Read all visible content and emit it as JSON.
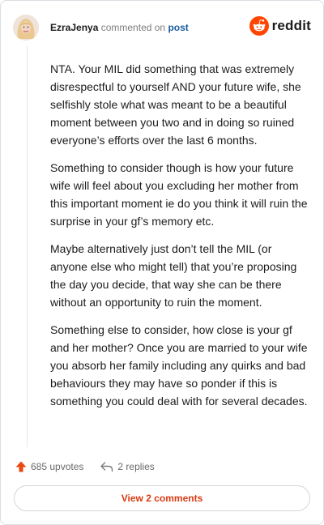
{
  "comment": {
    "username": "EzraJenya",
    "action_text": "commented on",
    "post_link": "post",
    "paragraphs": [
      "NTA. Your MIL did something that was extremely disrespectful to yourself AND your future wife, she selfishly stole what was meant to be a beautiful moment between you two and in doing so ruined everyone’s efforts over the last 6 months.",
      "Something to consider though is how your future wife will feel about you excluding her mother from this important moment ie do you think it will ruin the surprise in your gf’s memory etc.",
      "Maybe alternatively just don’t tell the MIL (or anyone else who might tell) that you’re proposing the day you decide, that way she can be there without an opportunity to ruin the moment.",
      "Something else to consider, how close is your gf and her mother? Once you are married to your wife you absorb her family including any quirks and bad behaviours they may have so ponder if this is something you could deal with for several decades."
    ]
  },
  "brand": {
    "wordmark": "reddit",
    "color": "#ff4500"
  },
  "actions": {
    "upvotes": "685 upvotes",
    "replies": "2 replies"
  },
  "footer": {
    "view_comments_label": "View 2 comments"
  },
  "colors": {
    "accent": "#d83a11",
    "link": "#1a5a9e",
    "upvote": "#e8490f"
  }
}
